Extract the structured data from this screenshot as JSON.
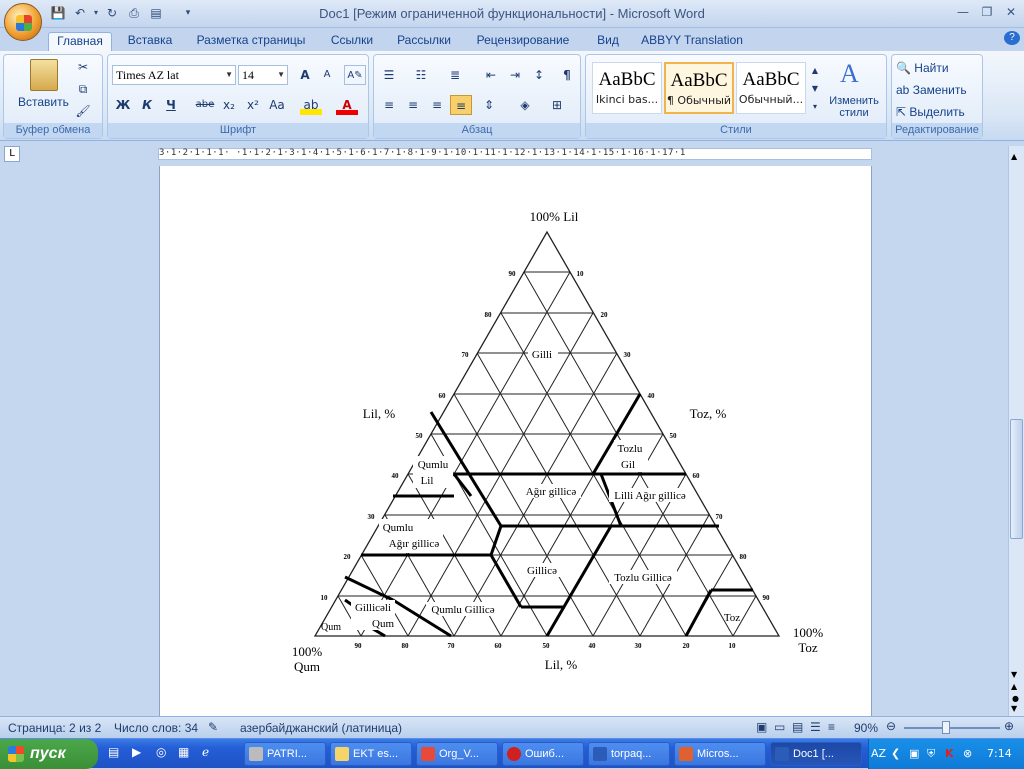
{
  "window": {
    "title": "Doc1 [Режим ограниченной функциональности] - Microsoft Word"
  },
  "tabs": [
    "Главная",
    "Вставка",
    "Разметка страницы",
    "Ссылки",
    "Рассылки",
    "Рецензирование",
    "Вид",
    "ABBYY Translation"
  ],
  "ribbon": {
    "clipboard": {
      "paste_label": "Вставить",
      "group_label": "Буфер обмена"
    },
    "font": {
      "font_name": "Times AZ lat",
      "font_size": "14",
      "group_label": "Шрифт",
      "bold": "Ж",
      "italic": "К",
      "underline": "Ч",
      "strike": "abe",
      "sub": "x₂",
      "sup": "x²",
      "case": "Aa",
      "grow": "A",
      "shrink": "A"
    },
    "paragraph": {
      "group_label": "Абзац"
    },
    "styles": {
      "group_label": "Стили",
      "items": [
        {
          "sample": "AaBbC",
          "name": "Ikinci bas..."
        },
        {
          "sample": "AaBbC",
          "name": "¶ Обычный"
        },
        {
          "sample": "AaBbC",
          "name": "Обычный..."
        }
      ],
      "change_label_1": "Изменить",
      "change_label_2": "стили"
    },
    "editing": {
      "find": "Найти",
      "replace": "Заменить",
      "select": "Выделить",
      "group_label": "Редактирование"
    }
  },
  "ruler": {
    "text": "3·1·2·1·1·1·  ·1·1·2·1·3·1·4·1·5·1·6·1·7·1·8·1·9·1·10·1·11·1·12·1·13·1·14·1·15·1·16·1·17·1"
  },
  "diagram": {
    "top_label": "100% Lil",
    "left_axis": "Lil, %",
    "right_axis": "Toz, %",
    "bl_1": "100%",
    "bl_2": "Qum",
    "br_1": "100%",
    "br_2": "Toz",
    "bottom_axis": "Lil, %",
    "left_ticks": [
      "90",
      "80",
      "70",
      "60",
      "50",
      "40",
      "30",
      "20",
      "10"
    ],
    "right_ticks": [
      "10",
      "20",
      "30",
      "40",
      "50",
      "60",
      "70",
      "80",
      "90"
    ],
    "bottom_ticks": [
      "90",
      "80",
      "70",
      "60",
      "50",
      "40",
      "30",
      "20",
      "10"
    ],
    "regions": {
      "gilli": "Gilli",
      "tozlu_gil_1": "Tozlu",
      "tozlu_gil_2": "Gil",
      "qumlu_lil_1": "Qumlu",
      "qumlu_lil_2": "Lil",
      "agir_gillice": "Ağır gillicə",
      "lilli_agir": "Lilli Ağır gillicə",
      "qumlu_agir_1": "Qumlu",
      "qumlu_agir_2": "Ağır gillicə",
      "gillice": "Gillicə",
      "tozlu_gillice": "Tozlu Gillicə",
      "gilliceli_1": "Gillicəli",
      "gilliceli_2": "Qum",
      "qum": "Qum",
      "qumlu_gillice": "Qumlu Gillicə",
      "toz": "Toz"
    }
  },
  "status": {
    "page": "Страница: 2 из 2",
    "words": "Число слов: 34",
    "lang": "азербайджанский (латиница)",
    "zoom": "90%"
  },
  "taskbar": {
    "start": "пуск",
    "items": [
      "PATRI...",
      "EKT es...",
      "Org_V...",
      "Ошиб...",
      "torpaq...",
      "Micros...",
      "Doc1 [..."
    ],
    "lang": "AZ",
    "time": "7:14"
  }
}
